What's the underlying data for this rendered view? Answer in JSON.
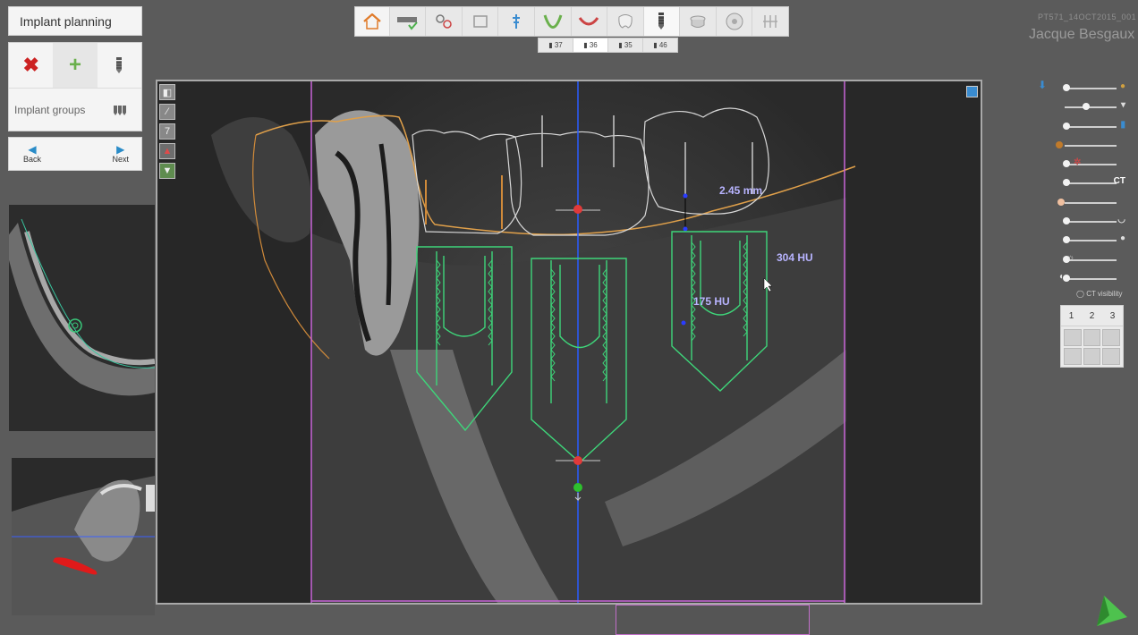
{
  "panel": {
    "title": "Implant planning",
    "implant_groups_label": "Implant groups",
    "back_label": "Back",
    "next_label": "Next"
  },
  "toolbar": {
    "items": [
      "home-icon",
      "scan-icon",
      "segment-icon",
      "panoramic-icon",
      "nerve-icon",
      "arch-icon",
      "teeth-icon",
      "crown-icon",
      "implant-icon",
      "sleeve-icon",
      "guide-icon",
      "export-icon"
    ],
    "tooth_tabs": [
      "37",
      "36",
      "35",
      "46"
    ],
    "selected_tab": "36"
  },
  "patient": {
    "id": "PT571_14OCT2015_001",
    "name": "Jacque Besgaux"
  },
  "measurements": {
    "distance": "2.45 mm",
    "density_1": "304 HU",
    "density_2": "175 HU"
  },
  "right_panel": {
    "ct_label": "CT",
    "ct_visibility": "CT visibility",
    "preset_numbers": [
      "1",
      "2",
      "3"
    ]
  },
  "colors": {
    "implant_outline": "#3ed67a",
    "crown_outline": "#d8d8d8",
    "gingiva_line": "#e0a04a",
    "axis_line": "#2a5cff",
    "bounds_line": "#c864d8",
    "label_text": "#b8b4ff",
    "delete_red": "#cc2222",
    "add_green": "#6ab04c"
  }
}
